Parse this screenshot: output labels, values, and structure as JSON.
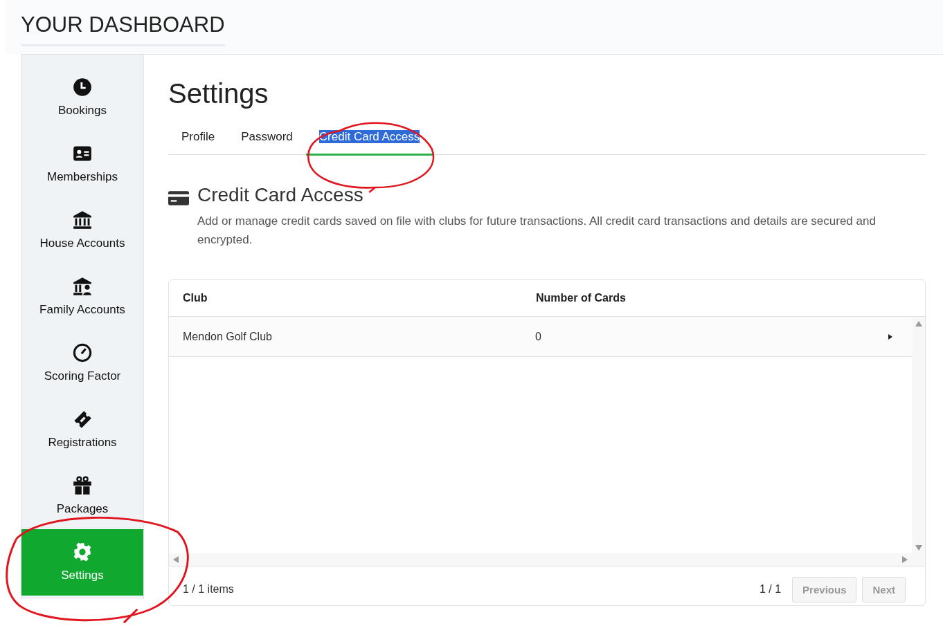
{
  "page_title": "YOUR DASHBOARD",
  "sidebar": {
    "items": [
      {
        "label": "Bookings",
        "selected": false
      },
      {
        "label": "Memberships",
        "selected": false
      },
      {
        "label": "House Accounts",
        "selected": false
      },
      {
        "label": "Family Accounts",
        "selected": false
      },
      {
        "label": "Scoring Factor",
        "selected": false
      },
      {
        "label": "Registrations",
        "selected": false
      },
      {
        "label": "Packages",
        "selected": false
      },
      {
        "label": "Settings",
        "selected": true
      }
    ]
  },
  "heading": "Settings",
  "tabs": [
    {
      "label": "Profile",
      "selected": false,
      "text_highlighted": false
    },
    {
      "label": "Password",
      "selected": false,
      "text_highlighted": false
    },
    {
      "label": "Credit Card Access",
      "selected": true,
      "text_highlighted": true
    }
  ],
  "section": {
    "title": "Credit Card Access",
    "description": "Add or manage credit cards saved on file with clubs for future transactions. All credit card transactions and details are secured and encrypted."
  },
  "table": {
    "columns": [
      "Club",
      "Number of Cards"
    ],
    "rows": [
      {
        "cells": [
          "Mendon Golf Club",
          "0"
        ]
      }
    ]
  },
  "footer": {
    "items_count": "1 / 1 items",
    "page": "1 / 1",
    "buttons": [
      {
        "label": "Previous",
        "disabled": true
      },
      {
        "label": "Next",
        "disabled": true
      }
    ]
  }
}
